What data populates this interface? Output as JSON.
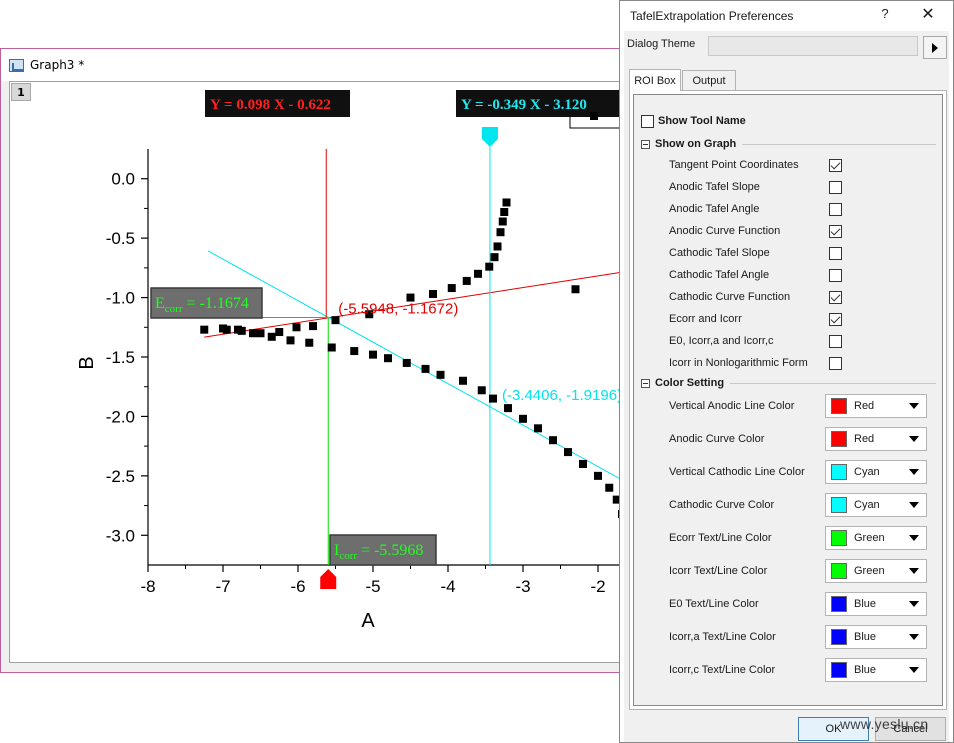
{
  "graph_window": {
    "title": "Graph3 *",
    "layer_number": "1"
  },
  "annotations": {
    "anodic_function": "Y = 0.098 X - 0.622",
    "cathodic_function": "Y = -0.349 X - 3.120",
    "ecorr_label": "E",
    "ecorr_sub": "corr",
    "ecorr_value": " = -1.1674",
    "icorr_label": "I",
    "icorr_sub": "corr",
    "icorr_value": " = -5.5968",
    "anodic_tangent_point": "(-5.5948, -1.1672)",
    "cathodic_tangent_point": "(-3.4406, -1.9196)"
  },
  "colors": {
    "anodic": "#e00000",
    "cathodic": "#00e5ee",
    "corr": "#00dd00",
    "label_bg_dark": "#101010",
    "label_bg_gray": "#6e6e6e"
  },
  "chart_data": {
    "type": "scatter",
    "xlabel": "A",
    "ylabel": "B",
    "xlim": [
      -8,
      -1.6
    ],
    "ylim": [
      -3.25,
      0.25
    ],
    "xticks": [
      -8,
      -7,
      -6,
      -5,
      -4,
      -3,
      -2
    ],
    "yticks": [
      0.0,
      -0.5,
      -1.0,
      -1.5,
      -2.0,
      -2.5,
      -3.0
    ],
    "xtick_labels": [
      "-8",
      "-7",
      "-6",
      "-5",
      "-4",
      "-3",
      "-2"
    ],
    "ytick_labels": [
      "0.0",
      "-0.5",
      "-1.0",
      "-1.5",
      "-2.0",
      "-2.5",
      "-3.0"
    ],
    "anodic_points": [
      [
        -7.25,
        -1.27
      ],
      [
        -6.95,
        -1.27
      ],
      [
        -6.75,
        -1.28
      ],
      [
        -6.5,
        -1.3
      ],
      [
        -6.25,
        -1.29
      ],
      [
        -6.02,
        -1.25
      ],
      [
        -5.8,
        -1.24
      ],
      [
        -5.5,
        -1.19
      ],
      [
        -5.05,
        -1.14
      ],
      [
        -4.5,
        -1.0
      ],
      [
        -4.2,
        -0.97
      ],
      [
        -3.95,
        -0.92
      ],
      [
        -3.75,
        -0.86
      ],
      [
        -3.6,
        -0.8
      ],
      [
        -3.45,
        -0.74
      ],
      [
        -3.38,
        -0.66
      ],
      [
        -3.34,
        -0.57
      ],
      [
        -3.3,
        -0.45
      ],
      [
        -3.27,
        -0.36
      ],
      [
        -3.25,
        -0.28
      ],
      [
        -3.22,
        -0.2
      ],
      [
        -2.3,
        -0.93
      ]
    ],
    "cathodic_points": [
      [
        -7.0,
        -1.26
      ],
      [
        -6.8,
        -1.27
      ],
      [
        -6.6,
        -1.3
      ],
      [
        -6.35,
        -1.33
      ],
      [
        -6.1,
        -1.36
      ],
      [
        -5.85,
        -1.38
      ],
      [
        -5.55,
        -1.42
      ],
      [
        -5.25,
        -1.45
      ],
      [
        -5.0,
        -1.48
      ],
      [
        -4.8,
        -1.51
      ],
      [
        -4.55,
        -1.55
      ],
      [
        -4.3,
        -1.6
      ],
      [
        -4.1,
        -1.65
      ],
      [
        -3.8,
        -1.7
      ],
      [
        -3.55,
        -1.78
      ],
      [
        -3.4,
        -1.85
      ],
      [
        -3.2,
        -1.93
      ],
      [
        -3.0,
        -2.02
      ],
      [
        -2.8,
        -2.1
      ],
      [
        -2.6,
        -2.2
      ],
      [
        -2.4,
        -2.3
      ],
      [
        -2.2,
        -2.4
      ],
      [
        -2.0,
        -2.5
      ],
      [
        -1.85,
        -2.6
      ],
      [
        -1.75,
        -2.7
      ],
      [
        -1.68,
        -2.82
      ]
    ],
    "ecorr": -1.1674,
    "icorr": -5.5968,
    "cathodic_tangent_x": -3.4406
  },
  "dialog": {
    "title": "TafelExtrapolation Preferences",
    "help": "?",
    "close": "✕",
    "theme_label": "Dialog Theme",
    "tabs": [
      "ROI Box",
      "Output"
    ],
    "show_tool_name": "Show Tool Name",
    "show_on_graph_header": "Show on Graph",
    "show_on_graph": [
      {
        "label": "Tangent Point Coordinates",
        "checked": true
      },
      {
        "label": "Anodic Tafel Slope",
        "checked": false
      },
      {
        "label": "Anodic Tafel Angle",
        "checked": false
      },
      {
        "label": "Anodic Curve Function",
        "checked": true
      },
      {
        "label": "Cathodic Tafel Slope",
        "checked": false
      },
      {
        "label": "Cathodic Tafel Angle",
        "checked": false
      },
      {
        "label": "Cathodic Curve Function",
        "checked": true
      },
      {
        "label": "Ecorr and Icorr",
        "checked": true
      },
      {
        "label": "E0, Icorr,a and Icorr,c",
        "checked": false
      },
      {
        "label": "Icorr in Nonlogarithmic Form",
        "checked": false
      }
    ],
    "color_setting_header": "Color Setting",
    "color_settings": [
      {
        "label": "Vertical Anodic Line Color",
        "value": "Red",
        "swatch": "#ff0000"
      },
      {
        "label": "Anodic Curve Color",
        "value": "Red",
        "swatch": "#ff0000"
      },
      {
        "label": "Vertical Cathodic Line Color",
        "value": "Cyan",
        "swatch": "#00ffff"
      },
      {
        "label": "Cathodic Curve Color",
        "value": "Cyan",
        "swatch": "#00ffff"
      },
      {
        "label": "Ecorr Text/Line Color",
        "value": "Green",
        "swatch": "#00ff00"
      },
      {
        "label": "Icorr Text/Line Color",
        "value": "Green",
        "swatch": "#00ff00"
      },
      {
        "label": "E0 Text/Line Color",
        "value": "Blue",
        "swatch": "#0000ff"
      },
      {
        "label": "Icorr,a Text/Line Color",
        "value": "Blue",
        "swatch": "#0000ff"
      },
      {
        "label": "Icorr,c Text/Line Color",
        "value": "Blue",
        "swatch": "#0000ff"
      }
    ],
    "ok_label": "OK",
    "cancel_label": "Cancel"
  },
  "watermark": "www.yeslu.cn"
}
